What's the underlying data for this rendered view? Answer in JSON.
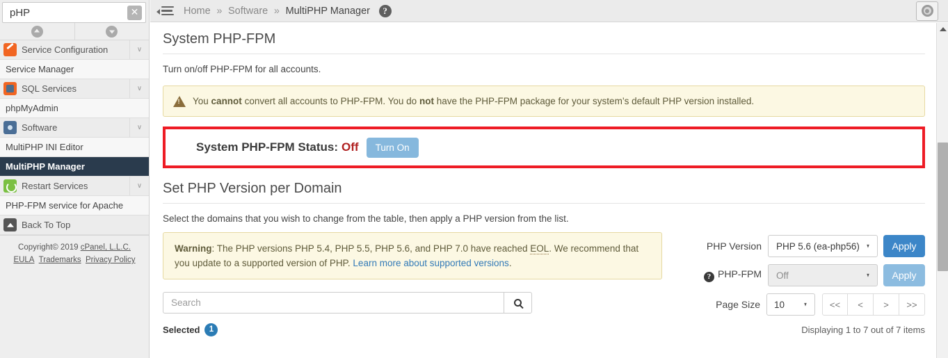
{
  "sidebar": {
    "search": {
      "value": "pHP",
      "placeholder": "",
      "clear_label": "✕"
    },
    "collapse_all_label": "",
    "expand_all_label": "",
    "items": [
      {
        "label": "Service Configuration",
        "type": "group",
        "icon": "wrench-icon",
        "caret": "∨"
      },
      {
        "label": "Service Manager",
        "type": "leaf",
        "active": false
      },
      {
        "label": "SQL Services",
        "type": "group",
        "icon": "database-icon",
        "caret": "∨"
      },
      {
        "label": "phpMyAdmin",
        "type": "leaf",
        "active": false
      },
      {
        "label": "Software",
        "type": "group",
        "icon": "software-icon",
        "caret": "∨"
      },
      {
        "label": "MultiPHP INI Editor",
        "type": "leaf",
        "active": false
      },
      {
        "label": "MultiPHP Manager",
        "type": "leaf",
        "active": true
      },
      {
        "label": "Restart Services",
        "type": "group",
        "icon": "restart-icon",
        "caret": "∨"
      },
      {
        "label": "PHP-FPM service for Apache",
        "type": "leaf",
        "active": false
      },
      {
        "label": "Back To Top",
        "type": "group",
        "icon": "back-to-top-icon",
        "caret": ""
      }
    ],
    "footer": {
      "copyright": "Copyright© 2019 ",
      "cpanel_link": "cPanel, L.L.C.",
      "eula": "EULA",
      "trademarks": "Trademarks",
      "privacy": "Privacy Policy"
    }
  },
  "topbar": {
    "breadcrumb": [
      {
        "label": "Home",
        "current": false
      },
      {
        "label": "Software",
        "current": false
      },
      {
        "label": "MultiPHP Manager",
        "current": true
      }
    ],
    "separator": "»",
    "help_label": "?",
    "lifesaver_title": ""
  },
  "main": {
    "section1": {
      "title": "System PHP-FPM",
      "description": "Turn on/off PHP-FPM for all accounts.",
      "alert": {
        "prefix": "You ",
        "bold1": "cannot",
        "mid": " convert all accounts to PHP-FPM. You do ",
        "bold2": "not",
        "suffix": " have the PHP-FPM package for your system’s default PHP version installed."
      },
      "status": {
        "label": "System PHP-FPM Status:",
        "value": "Off",
        "button_label": "Turn On",
        "highlight_color": "#ee1c25"
      }
    },
    "section2": {
      "title": "Set PHP Version per Domain",
      "description": "Select the domains that you wish to change from the table, then apply a PHP version from the list.",
      "warning": {
        "bold": "Warning",
        "text1": ": The PHP versions PHP 5.4, PHP 5.5, PHP 5.6, and PHP 7.0 have reached ",
        "abbr": "EOL",
        "text2": ". We recommend that you update to a supported version of PHP. ",
        "link": "Learn more about supported versions",
        "text3": "."
      },
      "search": {
        "placeholder": "Search",
        "value": ""
      },
      "selected": {
        "label": "Selected",
        "count": "1"
      },
      "controls": {
        "php_version_label": "PHP Version",
        "php_version_value": "PHP 5.6 (ea-php56)",
        "php_version_apply": "Apply",
        "php_fpm_label": "PHP-FPM",
        "php_fpm_help": "?",
        "php_fpm_value": "Off",
        "php_fpm_apply": "Apply",
        "page_size_label": "Page Size",
        "page_size_value": "10",
        "pager": [
          "<<",
          "<",
          ">",
          ">>"
        ],
        "displaying": "Displaying 1 to 7 out of 7 items"
      }
    }
  },
  "colors": {
    "accent_blue": "#3c86c8",
    "accent_blue_dim": "#8cbce0",
    "warning_bg": "#fcf8e3",
    "highlight_red": "#ee1c25",
    "sidebar_active": "#2a3b4d",
    "status_off": "#b02020"
  }
}
